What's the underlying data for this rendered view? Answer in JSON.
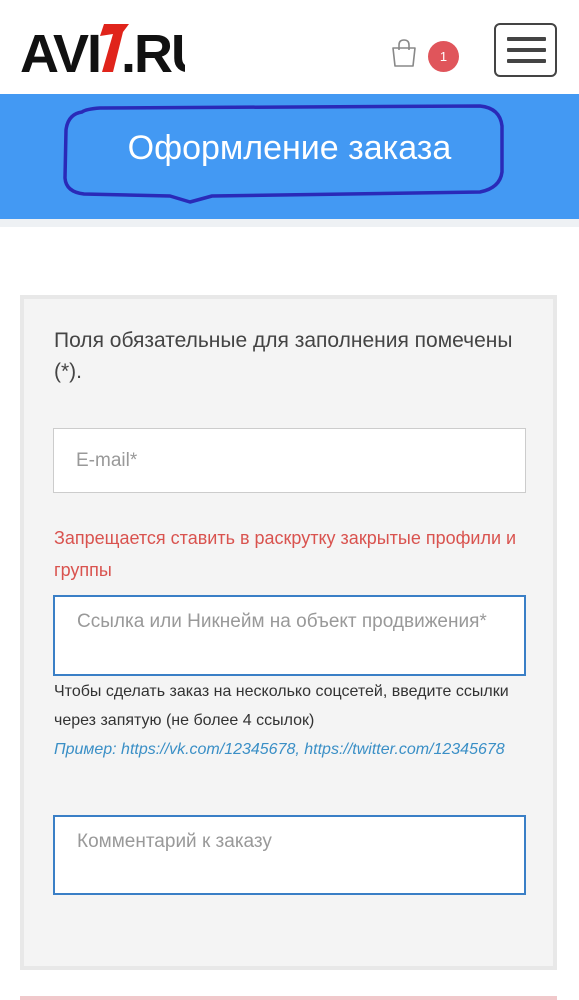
{
  "header": {
    "logo_text": "AVI7.RU",
    "cart_count": "1",
    "cart_icon": "shopping-bag-icon",
    "menu_icon": "hamburger-menu-icon"
  },
  "banner": {
    "title": "Оформление заказа",
    "background_color": "#4399f3"
  },
  "form": {
    "required_note": "Поля обязательные для заполнения помечены (*).",
    "email_placeholder": "E-mail*",
    "warning": "Запрещается ставить в раскрутку закрытые профили и группы",
    "link_placeholder": "Ссылка или Никнейм на объект продвижения*",
    "hint": "Чтобы сделать заказ на несколько соцсетей, введите ссылки через запятую (не более 4 ссылок)",
    "example": "Пример: https://vk.com/12345678, https://twitter.com/12345678",
    "comment_placeholder": "Комментарий к заказу"
  },
  "colors": {
    "accent": "#4399f3",
    "warning": "#d9534f",
    "link": "#3a8fc6",
    "badge": "#e0555b"
  }
}
